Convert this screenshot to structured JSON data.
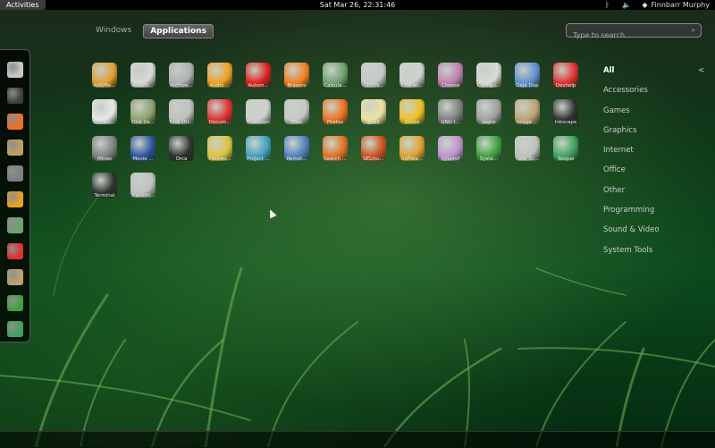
{
  "topbar": {
    "activities": "Activities",
    "clock": "Sat Mar 26, 22:31:46",
    "user": "Finnbarr Murphy",
    "icons": [
      "bluetooth-icon",
      "volume-icon",
      "user-icon"
    ]
  },
  "view": {
    "windows": "Windows",
    "applications": "Applications"
  },
  "search": {
    "placeholder": "Type to search..."
  },
  "dash": [
    "files-icon",
    "terminal-icon",
    "firefox-icon",
    "folder-icon",
    "pointer-icon",
    "rescue-icon",
    "calculator-icon",
    "evolution-icon",
    "image-viewer-icon",
    "system-monitor-icon",
    "tasks-icon"
  ],
  "apps": [
    {
      "label": "Add/Re...",
      "icon": "add-remove-icon",
      "color": "#e0a030"
    },
    {
      "label": "AisleRi...",
      "icon": "aisleriot-icon",
      "color": "#d8d8d8"
    },
    {
      "label": "Archive...",
      "icon": "archive-icon",
      "color": "#b0b0b0"
    },
    {
      "label": "Audio ...",
      "icon": "audio-cd-icon",
      "color": "#f0a020"
    },
    {
      "label": "Autom...",
      "icon": "automount-icon",
      "color": "#e02020"
    },
    {
      "label": "Brasero",
      "icon": "brasero-icon",
      "color": "#f08020"
    },
    {
      "label": "Calcula...",
      "icon": "calculator-icon",
      "color": "#70a070"
    },
    {
      "label": "CD/DV...",
      "icon": "cd-dvd-icon",
      "color": "#c8c8c8"
    },
    {
      "label": "Charac...",
      "icon": "character-map-icon",
      "color": "#d0d0d0"
    },
    {
      "label": "Cheese",
      "icon": "cheese-icon",
      "color": "#c080b0"
    },
    {
      "label": "Configu...",
      "icon": "configure-icon",
      "color": "#d8d8d8"
    },
    {
      "label": "Déjà Dup",
      "icon": "deja-dup-icon",
      "color": "#6090d0"
    },
    {
      "label": "Devhelp",
      "icon": "devhelp-icon",
      "color": "#e03030"
    },
    {
      "label": "Diction...",
      "icon": "dictionary-icon",
      "color": "#e8e8e8"
    },
    {
      "label": "Disk Us...",
      "icon": "disk-usage-icon",
      "color": "#90a070"
    },
    {
      "label": "Disk Uti...",
      "icon": "disk-utility-icon",
      "color": "#c0c0c0"
    },
    {
      "label": "Docum...",
      "icon": "document-viewer-icon",
      "color": "#e03030"
    },
    {
      "label": "Evolution",
      "icon": "evolution-icon",
      "color": "#d0d0d0"
    },
    {
      "label": "Files",
      "icon": "files-icon",
      "color": "#c8c8c8"
    },
    {
      "label": "Firefox",
      "icon": "firefox-icon",
      "color": "#f07020"
    },
    {
      "label": "gedit",
      "icon": "gedit-icon",
      "color": "#f0e0a0"
    },
    {
      "label": "Gnote",
      "icon": "gnote-icon",
      "color": "#f0c020"
    },
    {
      "label": "GNU I...",
      "icon": "gnu-image-icon",
      "color": "#808080"
    },
    {
      "label": "Iagno",
      "icon": "iagno-icon",
      "color": "#a0a0a0"
    },
    {
      "label": "Image ...",
      "icon": "image-viewer-icon",
      "color": "#c0a070"
    },
    {
      "label": "Inkscape",
      "icon": "inkscape-icon",
      "color": "#303030"
    },
    {
      "label": "Mines",
      "icon": "mines-icon",
      "color": "#808080"
    },
    {
      "label": "Movie ...",
      "icon": "movie-player-icon",
      "color": "#3050a0"
    },
    {
      "label": "Orca",
      "icon": "orca-icon",
      "color": "#303030"
    },
    {
      "label": "Passwo...",
      "icon": "passwords-icon",
      "color": "#e0c040"
    },
    {
      "label": "Project ...",
      "icon": "project-icon",
      "color": "#40a0c0"
    },
    {
      "label": "Remot...",
      "icon": "remote-desktop-icon",
      "color": "#5080c0"
    },
    {
      "label": "Search ...",
      "icon": "search-tool-icon",
      "color": "#e07020"
    },
    {
      "label": "SELinu...",
      "icon": "selinux-icon",
      "color": "#d05020"
    },
    {
      "label": "Softwa...",
      "icon": "software-icon",
      "color": "#e0a030"
    },
    {
      "label": "Sysprof",
      "icon": "sysprof-icon",
      "color": "#c090d0"
    },
    {
      "label": "Syste...",
      "icon": "system-monitor-icon",
      "color": "#40a040"
    },
    {
      "label": "Take Sc...",
      "icon": "screenshot-icon",
      "color": "#c0c0c0"
    },
    {
      "label": "Tasque",
      "icon": "tasque-icon",
      "color": "#40a060"
    },
    {
      "label": "Terminal",
      "icon": "terminal-icon",
      "color": "#303030"
    },
    {
      "label": "Transmi...",
      "icon": "transmission-icon",
      "color": "#c0c0c0"
    }
  ],
  "categories": [
    "All",
    "Accessories",
    "Games",
    "Graphics",
    "Internet",
    "Office",
    "Other",
    "Programming",
    "Sound & Video",
    "System Tools"
  ],
  "category_arrow": "<"
}
